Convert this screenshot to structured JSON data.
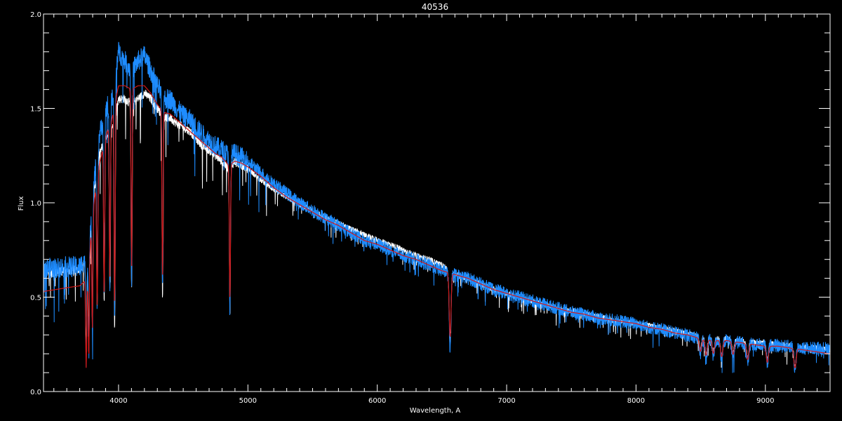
{
  "chart_data": {
    "type": "line",
    "title": "40536",
    "xlabel": "Wavelength, A",
    "ylabel": "Flux",
    "xlim": [
      3420,
      9500
    ],
    "ylim": [
      0.0,
      2.0
    ],
    "x_ticks": [
      4000,
      5000,
      6000,
      7000,
      8000,
      9000
    ],
    "x_tick_labels": [
      "4000",
      "5000",
      "6000",
      "7000",
      "8000",
      "9000"
    ],
    "y_ticks": [
      0.0,
      0.5,
      1.0,
      1.5,
      2.0
    ],
    "y_tick_labels": [
      "0.0",
      "0.5",
      "1.0",
      "1.5",
      "2.0"
    ],
    "grid": false,
    "background": "#000000",
    "axis_color": "#ffffff",
    "series": [
      {
        "color": "#ffffff",
        "x": [
          3420,
          3600,
          3700,
          3760,
          3800,
          3850,
          3900,
          3950,
          4000,
          4050,
          4100,
          4150,
          4200,
          4250,
          4300,
          4350,
          4400,
          4450,
          4500,
          4550,
          4600,
          4650,
          4700,
          4750,
          4800,
          4850,
          4900,
          4950,
          5000,
          5100,
          5200,
          5300,
          5400,
          5500,
          5600,
          5700,
          5800,
          5900,
          6000,
          6100,
          6200,
          6300,
          6400,
          6500,
          6550,
          6600,
          6700,
          6800,
          6900,
          7000,
          7100,
          7200,
          7300,
          7400,
          7500,
          7600,
          7700,
          7800,
          7900,
          8000,
          8100,
          8200,
          8300,
          8400,
          8500,
          8600,
          8700,
          8800,
          8900,
          9000,
          9100,
          9200,
          9300,
          9400,
          9500
        ],
        "y": [
          0.62,
          0.64,
          0.65,
          0.7,
          1.0,
          1.25,
          1.35,
          1.4,
          1.55,
          1.55,
          1.52,
          1.55,
          1.58,
          1.55,
          1.5,
          1.45,
          1.45,
          1.42,
          1.4,
          1.38,
          1.34,
          1.3,
          1.28,
          1.25,
          1.22,
          1.18,
          1.22,
          1.2,
          1.18,
          1.12,
          1.07,
          1.03,
          0.99,
          0.96,
          0.92,
          0.89,
          0.86,
          0.83,
          0.8,
          0.78,
          0.75,
          0.72,
          0.7,
          0.67,
          0.64,
          0.62,
          0.6,
          0.57,
          0.54,
          0.52,
          0.5,
          0.48,
          0.46,
          0.44,
          0.43,
          0.41,
          0.4,
          0.38,
          0.37,
          0.36,
          0.35,
          0.34,
          0.32,
          0.31,
          0.29,
          0.28,
          0.28,
          0.27,
          0.26,
          0.26,
          0.25,
          0.24,
          0.23,
          0.23,
          0.22
        ]
      },
      {
        "color": "#1e8cff",
        "x": [
          3420,
          3600,
          3700,
          3760,
          3800,
          3850,
          3900,
          3950,
          4000,
          4050,
          4100,
          4150,
          4200,
          4250,
          4300,
          4350,
          4400,
          4450,
          4500,
          4550,
          4600,
          4650,
          4700,
          4750,
          4800,
          4850,
          4900,
          4950,
          5000,
          5100,
          5200,
          5300,
          5400,
          5500,
          5600,
          5700,
          5800,
          5900,
          6000,
          6100,
          6200,
          6300,
          6400,
          6500,
          6550,
          6600,
          6700,
          6800,
          6900,
          7000,
          7100,
          7200,
          7300,
          7400,
          7500,
          7600,
          7700,
          7800,
          7900,
          8000,
          8100,
          8200,
          8300,
          8400,
          8500,
          8600,
          8700,
          8800,
          8900,
          9000,
          9100,
          9200,
          9300,
          9400,
          9500
        ],
        "y": [
          0.65,
          0.66,
          0.66,
          0.72,
          1.05,
          1.35,
          1.5,
          1.55,
          1.8,
          1.75,
          1.7,
          1.75,
          1.78,
          1.7,
          1.62,
          1.55,
          1.55,
          1.5,
          1.46,
          1.44,
          1.4,
          1.36,
          1.33,
          1.3,
          1.28,
          1.25,
          1.26,
          1.24,
          1.22,
          1.16,
          1.1,
          1.05,
          1.0,
          0.96,
          0.92,
          0.88,
          0.84,
          0.8,
          0.78,
          0.75,
          0.72,
          0.7,
          0.67,
          0.64,
          0.63,
          0.62,
          0.6,
          0.57,
          0.54,
          0.52,
          0.5,
          0.48,
          0.46,
          0.44,
          0.42,
          0.41,
          0.39,
          0.38,
          0.37,
          0.36,
          0.34,
          0.33,
          0.31,
          0.3,
          0.28,
          0.27,
          0.27,
          0.26,
          0.25,
          0.25,
          0.24,
          0.24,
          0.23,
          0.23,
          0.23
        ]
      },
      {
        "color": "#d01818",
        "x": [
          3420,
          3600,
          3700,
          3760,
          3800,
          3850,
          3900,
          3950,
          4000,
          4050,
          4100,
          4150,
          4200,
          4250,
          4300,
          4350,
          4400,
          4450,
          4500,
          4550,
          4600,
          4650,
          4700,
          4750,
          4800,
          4850,
          4900,
          4950,
          5000,
          5100,
          5200,
          5300,
          5400,
          5500,
          5600,
          5700,
          5800,
          5900,
          6000,
          6100,
          6200,
          6300,
          6400,
          6500,
          6550,
          6600,
          6700,
          6800,
          6900,
          7000,
          7100,
          7200,
          7300,
          7400,
          7500,
          7600,
          7700,
          7800,
          7900,
          8000,
          8100,
          8200,
          8300,
          8400,
          8500,
          8600,
          8700,
          8800,
          8900,
          9000,
          9100,
          9200,
          9300,
          9400,
          9500
        ],
        "y": [
          0.53,
          0.55,
          0.56,
          0.6,
          0.95,
          1.2,
          1.35,
          1.45,
          1.62,
          1.62,
          1.6,
          1.62,
          1.62,
          1.58,
          1.52,
          1.48,
          1.47,
          1.44,
          1.41,
          1.38,
          1.35,
          1.32,
          1.29,
          1.26,
          1.24,
          1.2,
          1.22,
          1.21,
          1.19,
          1.14,
          1.08,
          1.03,
          0.99,
          0.95,
          0.91,
          0.88,
          0.84,
          0.8,
          0.78,
          0.75,
          0.72,
          0.7,
          0.67,
          0.64,
          0.63,
          0.62,
          0.6,
          0.57,
          0.54,
          0.52,
          0.5,
          0.48,
          0.46,
          0.44,
          0.42,
          0.41,
          0.39,
          0.38,
          0.37,
          0.36,
          0.34,
          0.33,
          0.31,
          0.3,
          0.28,
          0.27,
          0.27,
          0.26,
          0.25,
          0.24,
          0.24,
          0.23,
          0.22,
          0.21,
          0.2
        ]
      }
    ],
    "absorption_lines": [
      {
        "x": 3750,
        "depth": 0.55
      },
      {
        "x": 3770,
        "depth": 0.6
      },
      {
        "x": 3798,
        "depth": 0.7
      },
      {
        "x": 3835,
        "depth": 0.8
      },
      {
        "x": 3889,
        "depth": 0.95
      },
      {
        "x": 3933,
        "depth": 0.95
      },
      {
        "x": 3970,
        "depth": 1.25
      },
      {
        "x": 4101,
        "depth": 1.1
      },
      {
        "x": 4340,
        "depth": 1.05
      },
      {
        "x": 4861,
        "depth": 0.85
      },
      {
        "x": 6563,
        "depth": 0.4
      },
      {
        "x": 8498,
        "depth": 0.08
      },
      {
        "x": 8542,
        "depth": 0.1
      },
      {
        "x": 8598,
        "depth": 0.08
      },
      {
        "x": 8662,
        "depth": 0.1
      },
      {
        "x": 8750,
        "depth": 0.08
      },
      {
        "x": 8863,
        "depth": 0.1
      },
      {
        "x": 9015,
        "depth": 0.1
      },
      {
        "x": 9229,
        "depth": 0.12
      }
    ]
  }
}
